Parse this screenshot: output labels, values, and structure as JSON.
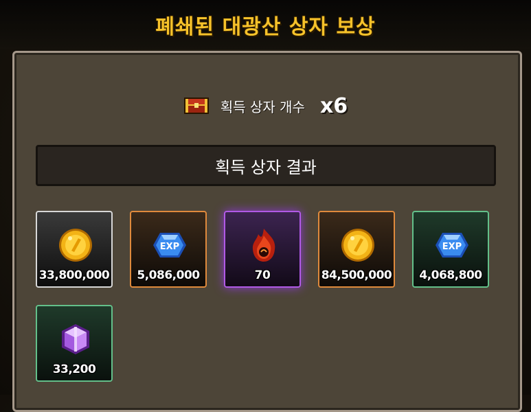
{
  "title": "폐쇄된 대광산 상자 보상",
  "count": {
    "label": "획득 상자 개수",
    "value": "x6",
    "icon": "chest-icon"
  },
  "result_header": "획득 상자 결과",
  "items": [
    {
      "icon": "gold-coin-icon",
      "value": "33,800,000",
      "rarity": "white"
    },
    {
      "icon": "exp-crystal-icon",
      "value": "5,086,000",
      "rarity": "orange"
    },
    {
      "icon": "fire-essence-icon",
      "value": "70",
      "rarity": "purple"
    },
    {
      "icon": "gold-coin-icon",
      "value": "84,500,000",
      "rarity": "orange"
    },
    {
      "icon": "exp-crystal-icon",
      "value": "4,068,800",
      "rarity": "green"
    },
    {
      "icon": "purple-cube-icon",
      "value": "33,200",
      "rarity": "green"
    }
  ]
}
